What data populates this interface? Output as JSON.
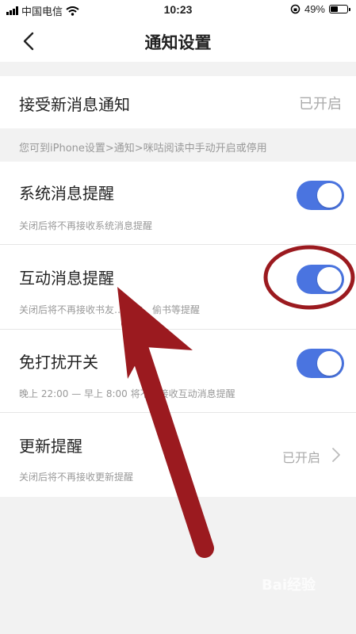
{
  "status_bar": {
    "carrier": "中国电信",
    "time": "10:23",
    "battery": "49%",
    "battery_level": 0.49
  },
  "nav": {
    "title": "通知设置"
  },
  "receive": {
    "label": "接受新消息通知",
    "value": "已开启"
  },
  "hint": "您可到iPhone设置>通知>咪咕阅读中手动开启或停用",
  "settings": [
    {
      "label": "系统消息提醒",
      "desc": "关闭后将不再接收系统消息提醒",
      "on": true
    },
    {
      "label": "互动消息提醒",
      "desc": "关闭后将不再接收书友…关注、偷书等提醒",
      "on": true
    },
    {
      "label": "免打扰开关",
      "desc": "晚上 22:00 — 早上 8:00 将不再接收互动消息提醒",
      "on": true
    }
  ],
  "update": {
    "label": "更新提醒",
    "desc": "关闭后将不再接收更新提醒",
    "value": "已开启"
  },
  "colors": {
    "toggle_on": "#4a74e0",
    "annotation": "#9b1a1f"
  },
  "watermark": "Bai经验"
}
